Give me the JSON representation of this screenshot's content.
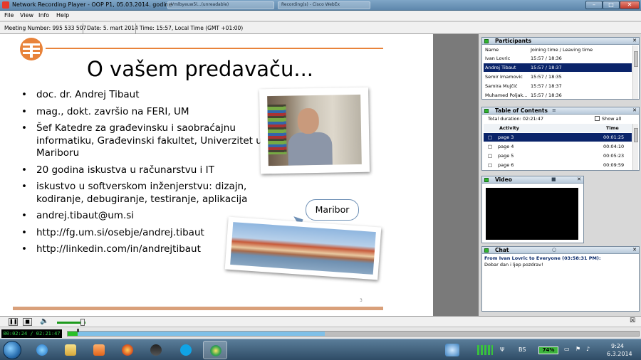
{
  "window": {
    "title": "Network Recording Player - OOP P1, 05.03.2014. godine",
    "ghost_tabs": [
      "Vmlbyeuw5l...(unreadable)",
      "Recording(s) - Cisco WebEx"
    ]
  },
  "menu": {
    "items": [
      "File",
      "View",
      "Info",
      "Help"
    ]
  },
  "info": {
    "meeting_number": "Meeting Number: 995 533 507",
    "date": "Date: 5. mart 2014",
    "time": "Time: 15:57, Local Time (GMT +01:00)"
  },
  "slide": {
    "title": "O vašem predavaču...",
    "bullets": [
      "doc. dr. Andrej Tibaut",
      "mag., dokt. završio na FERI, UM",
      "Šef Katedre za građevinsku i saobraćajnu informatiku, Građevinski fakultet, Univerzitet u Mariboru",
      "20 godina iskustva u računarstvu i IT",
      "iskustvo u softverskom inženjerstvu: dizajn, kodiranje, debugiranje, testiranje, aplikacija",
      "andrej.tibaut@um.si",
      "http://fg.um.si/osebje/andrej.tibaut",
      "http://linkedin.com/in/andrejtibaut"
    ],
    "callout": "Maribor",
    "page_number": "3"
  },
  "participants": {
    "title": "Participants",
    "columns": [
      "Name",
      "Joining time / Leaving time"
    ],
    "rows": [
      {
        "name": "Ivan Lovric",
        "time": "15:57 / 18:36"
      },
      {
        "name": "Andrej Tibaut",
        "time": "15:57 / 18:37",
        "selected": true
      },
      {
        "name": "Semir Imamovic",
        "time": "15:57 / 18:35"
      },
      {
        "name": "Samira Mujčić",
        "time": "15:57 / 18:37"
      },
      {
        "name": "Muhamed Poljak...",
        "time": "15:57 / 18:36"
      }
    ]
  },
  "toc": {
    "title": "Table of Contents",
    "total_duration": "Total duration: 02:21:47",
    "show_all": "Show all",
    "columns": [
      "Activity",
      "Time"
    ],
    "rows": [
      {
        "activity": "page 3",
        "time": "00:01:25",
        "selected": true
      },
      {
        "activity": "page 4",
        "time": "00:04:10"
      },
      {
        "activity": "page 5",
        "time": "00:05:23"
      },
      {
        "activity": "page 6",
        "time": "00:09:59"
      }
    ]
  },
  "video": {
    "title": "Video"
  },
  "chat": {
    "title": "Chat",
    "from": "From Ivan Lovric to Everyone (03:58:31 PM):",
    "message": "Dobar dan i ljep pozdrav!"
  },
  "playback": {
    "time_display": "00:02:24 / 02:21:47",
    "played_fraction": 0.017,
    "loaded_fraction": 0.45,
    "volume_fraction": 0.9
  },
  "taskbar": {
    "apps": [
      "start",
      "internet-explorer",
      "file-explorer",
      "media-player",
      "firefox",
      "webex",
      "skype",
      "network-recording-player"
    ],
    "battery": "74%",
    "language": "BS",
    "clock_time": "9:24",
    "clock_date": "6.3.2014"
  },
  "colors": {
    "accent_orange": "#e8833a",
    "selection": "#0a246a",
    "progress_green": "#28c028",
    "title_bar": "#6e93b5"
  }
}
